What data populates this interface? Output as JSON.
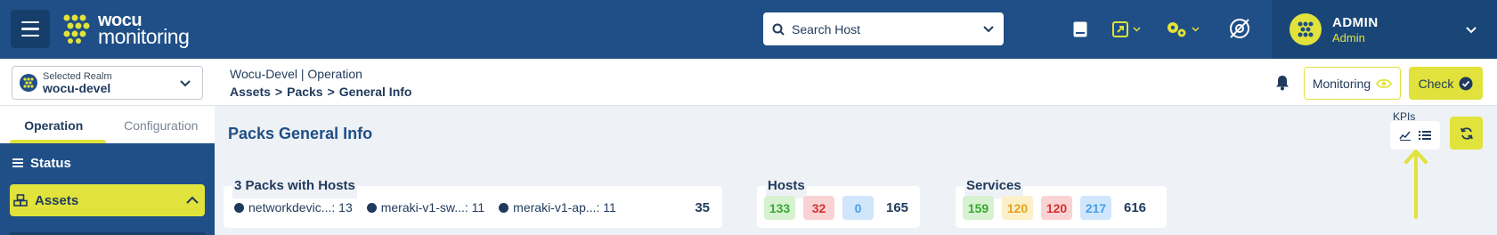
{
  "colors": {
    "primary": "#1f4f86",
    "accent": "#e1e23b",
    "text": "#1f3a5c"
  },
  "logo": {
    "line1": "wocu",
    "line2": "monitoring"
  },
  "search": {
    "placeholder": "Search Host"
  },
  "header_icons": [
    "notes-icon",
    "external-link-icon",
    "gears-icon",
    "no-signal-icon"
  ],
  "user": {
    "name": "ADMIN",
    "role": "Admin"
  },
  "realm": {
    "label": "Selected Realm",
    "value": "wocu-devel"
  },
  "breadcrumb": {
    "context": "Wocu-Devel | Operation",
    "path": [
      "Assets",
      ">",
      "Packs",
      ">",
      "General Info"
    ]
  },
  "actions": {
    "monitoring": "Monitoring",
    "check": "Check"
  },
  "sidebar": {
    "tabs": [
      {
        "label": "Operation",
        "active": true
      },
      {
        "label": "Configuration",
        "active": false
      }
    ],
    "items": [
      {
        "label": "Status",
        "icon": "list-icon"
      },
      {
        "label": "Assets",
        "icon": "cubes-icon",
        "active": true
      }
    ]
  },
  "main": {
    "title": "Packs General Info",
    "kpis_label": "KPIs"
  },
  "packs_card": {
    "title": "3 Packs with Hosts",
    "items": [
      {
        "name": "networkdevic...",
        "count": ": 13"
      },
      {
        "name": "meraki-v1-sw...",
        "count": ": 11"
      },
      {
        "name": "meraki-v1-ap...",
        "count": ": 11"
      }
    ],
    "total": "35"
  },
  "hosts_card": {
    "title": "Hosts",
    "badges": [
      {
        "value": "133",
        "bg": "#d6f2d1",
        "fg": "#3aa832"
      },
      {
        "value": "32",
        "bg": "#f9d3d3",
        "fg": "#d63030"
      },
      {
        "value": "0",
        "bg": "#cfe6fb",
        "fg": "#47a0e8"
      }
    ],
    "total": "165"
  },
  "services_card": {
    "title": "Services",
    "badges": [
      {
        "value": "159",
        "bg": "#d6f2d1",
        "fg": "#3aa832"
      },
      {
        "value": "120",
        "bg": "#fcf0c9",
        "fg": "#e8a020"
      },
      {
        "value": "120",
        "bg": "#f9d3d3",
        "fg": "#d63030"
      },
      {
        "value": "217",
        "bg": "#cfe6fb",
        "fg": "#47a0e8"
      }
    ],
    "total": "616"
  }
}
